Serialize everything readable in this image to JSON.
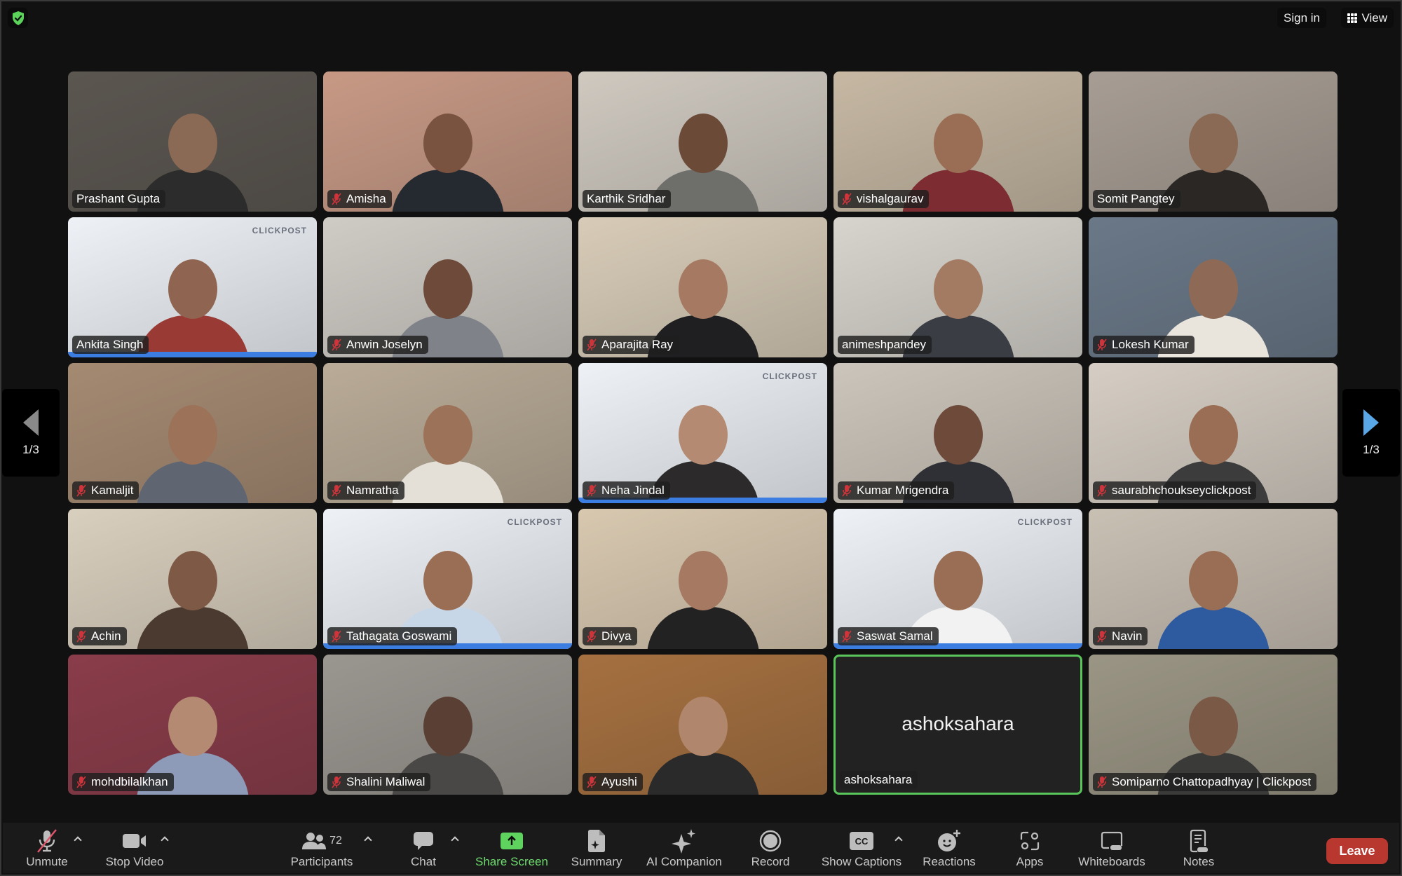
{
  "window": {
    "security_icon": "shield-check-icon",
    "top_buttons": {
      "sign_in": "Sign in",
      "view": "View",
      "view_icon": "grid-icon"
    }
  },
  "pagination": {
    "prev_label": "1/3",
    "next_label": "1/3",
    "current_page": 1,
    "total_pages": 3
  },
  "participants": [
    {
      "name": "Prashant Gupta",
      "muted": false,
      "bg": "#5b5650",
      "skin": "#8a6a55",
      "shirt": "#2c2c2c"
    },
    {
      "name": "Amisha",
      "muted": true,
      "bg": "#c79985",
      "skin": "#7a5240",
      "shirt": "#252a30"
    },
    {
      "name": "Karthik Sridhar",
      "muted": false,
      "bg": "#cfc9c0",
      "skin": "#6c4a38",
      "shirt": "#6e6e6b"
    },
    {
      "name": "vishalgaurav",
      "muted": true,
      "bg": "#c6b8a3",
      "skin": "#9a6e55",
      "shirt": "#7d2c32"
    },
    {
      "name": "Somit Pangtey",
      "muted": false,
      "bg": "#a79d94",
      "skin": "#8a6a55",
      "shirt": "#2a2725"
    },
    {
      "name": "Ankita Singh",
      "muted": false,
      "bg": "#eef2f7",
      "skin": "#8f6450",
      "shirt": "#9a3a34",
      "branded": true
    },
    {
      "name": "Anwin Joselyn",
      "muted": true,
      "bg": "#cfcbc5",
      "skin": "#6d4a3a",
      "shirt": "#7f8288"
    },
    {
      "name": "Aparajita Ray",
      "muted": true,
      "bg": "#d8ccb8",
      "skin": "#a67a62",
      "shirt": "#1f1f22"
    },
    {
      "name": "animeshpandey",
      "muted": false,
      "bg": "#d7d4cd",
      "skin": "#a37a62",
      "shirt": "#3a3d44"
    },
    {
      "name": "Lokesh Kumar",
      "muted": true,
      "bg": "#6a7888",
      "skin": "#8e6a56",
      "shirt": "#e9e4dc"
    },
    {
      "name": "Kamaljit",
      "muted": true,
      "bg": "#a58a72",
      "skin": "#9c7258",
      "shirt": "#5f6672"
    },
    {
      "name": "Namratha",
      "muted": true,
      "bg": "#b9ab97",
      "skin": "#9c7258",
      "shirt": "#e4e0d8"
    },
    {
      "name": "Neha Jindal",
      "muted": true,
      "bg": "#eef2f7",
      "skin": "#b58a72",
      "shirt": "#2c2a2a",
      "branded": true
    },
    {
      "name": "Kumar Mrigendra",
      "muted": true,
      "bg": "#ccc5bb",
      "skin": "#6d4a3a",
      "shirt": "#2f3036"
    },
    {
      "name": "saurabhchoukseyclickpost",
      "muted": true,
      "bg": "#d6cec4",
      "skin": "#9a6e55",
      "shirt": "#3c3c3c"
    },
    {
      "name": "Achin",
      "muted": true,
      "bg": "#d9cfbe",
      "skin": "#7e5a46",
      "shirt": "#4a3a2f"
    },
    {
      "name": "Tathagata Goswami",
      "muted": true,
      "bg": "#eef2f7",
      "skin": "#9a6e55",
      "shirt": "#c7d7e8",
      "branded": true
    },
    {
      "name": "Divya",
      "muted": true,
      "bg": "#d8c8b0",
      "skin": "#a67a62",
      "shirt": "#222222"
    },
    {
      "name": "Saswat Samal",
      "muted": true,
      "bg": "#eef2f7",
      "skin": "#9a6e55",
      "shirt": "#f2f2f2",
      "branded": true
    },
    {
      "name": "Navin",
      "muted": true,
      "bg": "#c9c0b4",
      "skin": "#9a6e55",
      "shirt": "#2e5aa0"
    },
    {
      "name": "mohdbilalkhan",
      "muted": true,
      "bg": "#8a3c4a",
      "skin": "#b58a72",
      "shirt": "#8d9ab8"
    },
    {
      "name": "Shalini Maliwal",
      "muted": true,
      "bg": "#9a9690",
      "skin": "#5a4034",
      "shirt": "#4a4846"
    },
    {
      "name": "Ayushi",
      "muted": true,
      "bg": "#a57040",
      "skin": "#b0866c",
      "shirt": "#2a2a2a"
    },
    {
      "name": "ashoksahara",
      "muted": false,
      "video_off": true,
      "active_speaker": true,
      "bg": "#222222"
    },
    {
      "name": "Somiparno Chattopadhyay | Clickpost",
      "muted": true,
      "bg": "#9a9584",
      "skin": "#7a5a46",
      "shirt": "#3a3a38"
    }
  ],
  "brand_mark": "CLICKPOST",
  "toolbar": {
    "unmute": "Unmute",
    "stop_video": "Stop Video",
    "participants": "Participants",
    "participant_count": "72",
    "chat": "Chat",
    "share_screen": "Share Screen",
    "summary": "Summary",
    "ai_companion": "AI Companion",
    "record": "Record",
    "show_captions": "Show Captions",
    "captions_badge": "CC",
    "reactions": "Reactions",
    "apps": "Apps",
    "whiteboards": "Whiteboards",
    "notes": "Notes",
    "leave": "Leave"
  },
  "colors": {
    "share_green": "#6fdc6f",
    "leave_red": "#b8372f",
    "active_speaker_border": "#5ac55a",
    "pager_next": "#5aa7e8",
    "muted_red": "#d0343a"
  }
}
